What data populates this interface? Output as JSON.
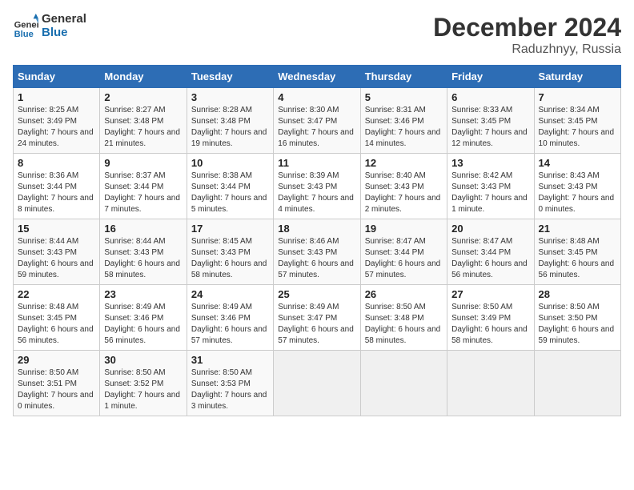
{
  "header": {
    "logo_line1": "General",
    "logo_line2": "Blue",
    "month": "December 2024",
    "location": "Raduzhnyy, Russia"
  },
  "days_of_week": [
    "Sunday",
    "Monday",
    "Tuesday",
    "Wednesday",
    "Thursday",
    "Friday",
    "Saturday"
  ],
  "weeks": [
    [
      {
        "day": "1",
        "sunrise": "8:25 AM",
        "sunset": "3:49 PM",
        "daylight": "7 hours and 24 minutes."
      },
      {
        "day": "2",
        "sunrise": "8:27 AM",
        "sunset": "3:48 PM",
        "daylight": "7 hours and 21 minutes."
      },
      {
        "day": "3",
        "sunrise": "8:28 AM",
        "sunset": "3:48 PM",
        "daylight": "7 hours and 19 minutes."
      },
      {
        "day": "4",
        "sunrise": "8:30 AM",
        "sunset": "3:47 PM",
        "daylight": "7 hours and 16 minutes."
      },
      {
        "day": "5",
        "sunrise": "8:31 AM",
        "sunset": "3:46 PM",
        "daylight": "7 hours and 14 minutes."
      },
      {
        "day": "6",
        "sunrise": "8:33 AM",
        "sunset": "3:45 PM",
        "daylight": "7 hours and 12 minutes."
      },
      {
        "day": "7",
        "sunrise": "8:34 AM",
        "sunset": "3:45 PM",
        "daylight": "7 hours and 10 minutes."
      }
    ],
    [
      {
        "day": "8",
        "sunrise": "8:36 AM",
        "sunset": "3:44 PM",
        "daylight": "7 hours and 8 minutes."
      },
      {
        "day": "9",
        "sunrise": "8:37 AM",
        "sunset": "3:44 PM",
        "daylight": "7 hours and 7 minutes."
      },
      {
        "day": "10",
        "sunrise": "8:38 AM",
        "sunset": "3:44 PM",
        "daylight": "7 hours and 5 minutes."
      },
      {
        "day": "11",
        "sunrise": "8:39 AM",
        "sunset": "3:43 PM",
        "daylight": "7 hours and 4 minutes."
      },
      {
        "day": "12",
        "sunrise": "8:40 AM",
        "sunset": "3:43 PM",
        "daylight": "7 hours and 2 minutes."
      },
      {
        "day": "13",
        "sunrise": "8:42 AM",
        "sunset": "3:43 PM",
        "daylight": "7 hours and 1 minute."
      },
      {
        "day": "14",
        "sunrise": "8:43 AM",
        "sunset": "3:43 PM",
        "daylight": "7 hours and 0 minutes."
      }
    ],
    [
      {
        "day": "15",
        "sunrise": "8:44 AM",
        "sunset": "3:43 PM",
        "daylight": "6 hours and 59 minutes."
      },
      {
        "day": "16",
        "sunrise": "8:44 AM",
        "sunset": "3:43 PM",
        "daylight": "6 hours and 58 minutes."
      },
      {
        "day": "17",
        "sunrise": "8:45 AM",
        "sunset": "3:43 PM",
        "daylight": "6 hours and 58 minutes."
      },
      {
        "day": "18",
        "sunrise": "8:46 AM",
        "sunset": "3:43 PM",
        "daylight": "6 hours and 57 minutes."
      },
      {
        "day": "19",
        "sunrise": "8:47 AM",
        "sunset": "3:44 PM",
        "daylight": "6 hours and 57 minutes."
      },
      {
        "day": "20",
        "sunrise": "8:47 AM",
        "sunset": "3:44 PM",
        "daylight": "6 hours and 56 minutes."
      },
      {
        "day": "21",
        "sunrise": "8:48 AM",
        "sunset": "3:45 PM",
        "daylight": "6 hours and 56 minutes."
      }
    ],
    [
      {
        "day": "22",
        "sunrise": "8:48 AM",
        "sunset": "3:45 PM",
        "daylight": "6 hours and 56 minutes."
      },
      {
        "day": "23",
        "sunrise": "8:49 AM",
        "sunset": "3:46 PM",
        "daylight": "6 hours and 56 minutes."
      },
      {
        "day": "24",
        "sunrise": "8:49 AM",
        "sunset": "3:46 PM",
        "daylight": "6 hours and 57 minutes."
      },
      {
        "day": "25",
        "sunrise": "8:49 AM",
        "sunset": "3:47 PM",
        "daylight": "6 hours and 57 minutes."
      },
      {
        "day": "26",
        "sunrise": "8:50 AM",
        "sunset": "3:48 PM",
        "daylight": "6 hours and 58 minutes."
      },
      {
        "day": "27",
        "sunrise": "8:50 AM",
        "sunset": "3:49 PM",
        "daylight": "6 hours and 58 minutes."
      },
      {
        "day": "28",
        "sunrise": "8:50 AM",
        "sunset": "3:50 PM",
        "daylight": "6 hours and 59 minutes."
      }
    ],
    [
      {
        "day": "29",
        "sunrise": "8:50 AM",
        "sunset": "3:51 PM",
        "daylight": "7 hours and 0 minutes."
      },
      {
        "day": "30",
        "sunrise": "8:50 AM",
        "sunset": "3:52 PM",
        "daylight": "7 hours and 1 minute."
      },
      {
        "day": "31",
        "sunrise": "8:50 AM",
        "sunset": "3:53 PM",
        "daylight": "7 hours and 3 minutes."
      },
      null,
      null,
      null,
      null
    ]
  ]
}
